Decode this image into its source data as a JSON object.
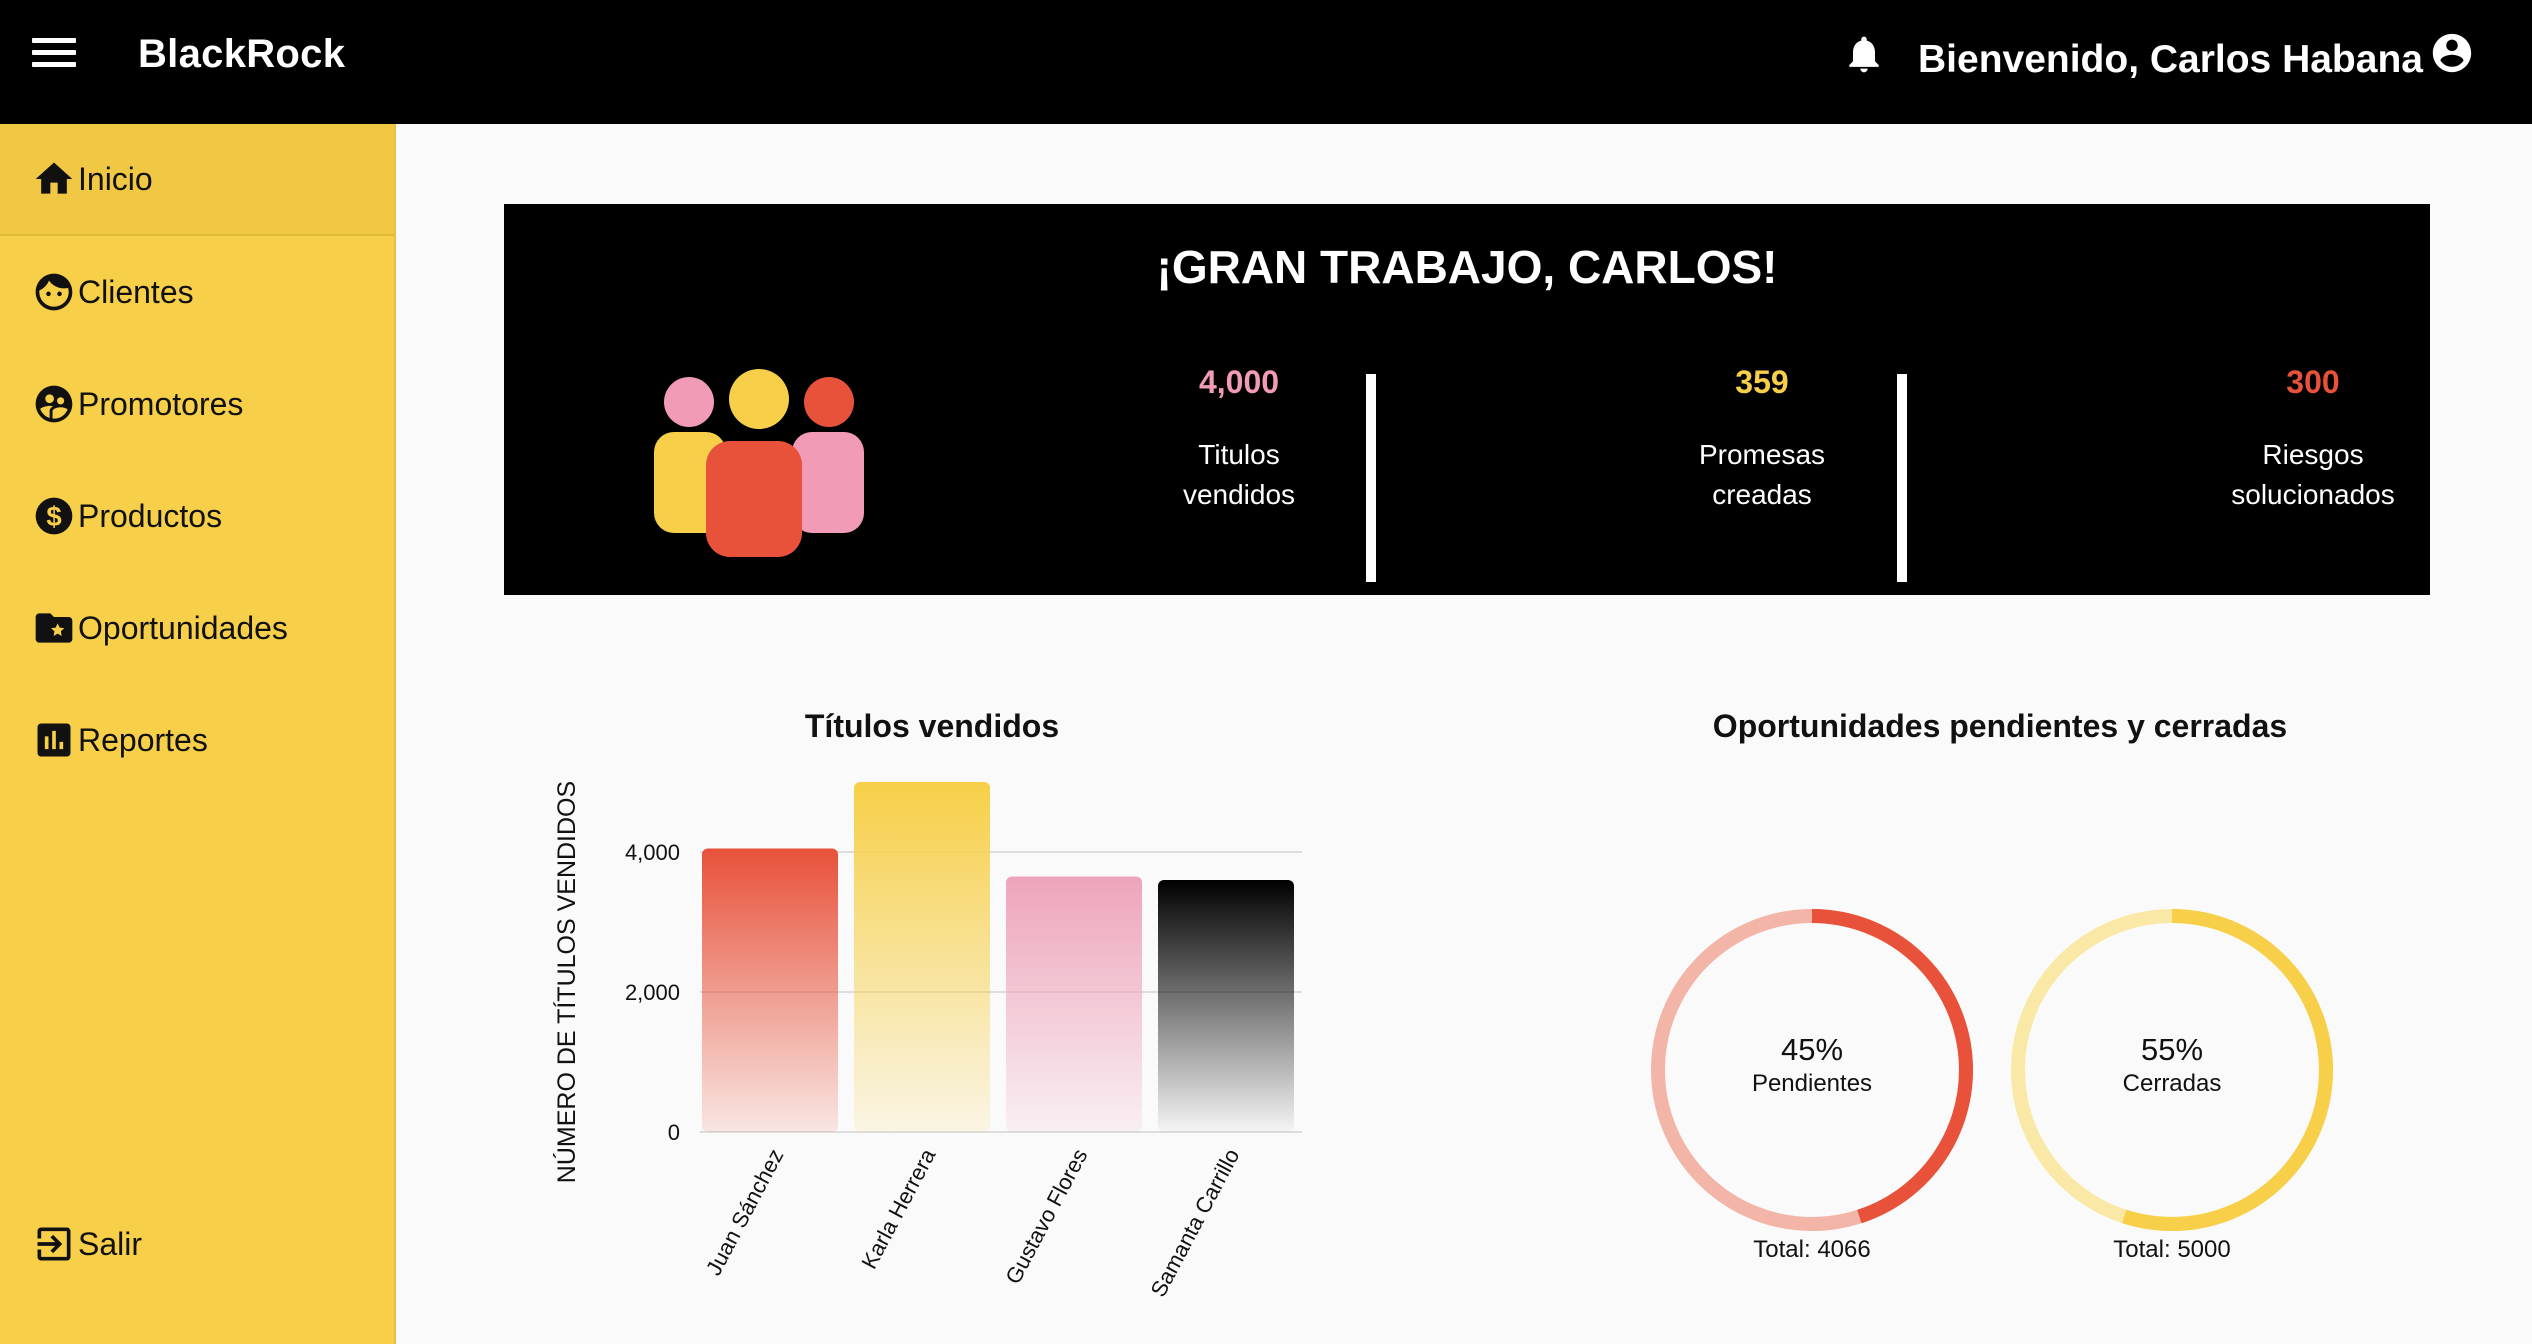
{
  "header": {
    "brand": "BlackRock",
    "welcome": "Bienvenido, Carlos Habana"
  },
  "sidebar": {
    "items": [
      {
        "label": "Inicio",
        "icon": "home-icon",
        "active": true
      },
      {
        "label": "Clientes",
        "icon": "face-icon"
      },
      {
        "label": "Promotores",
        "icon": "group-icon"
      },
      {
        "label": "Productos",
        "icon": "dollar-icon"
      },
      {
        "label": "Oportunidades",
        "icon": "folder-star-icon"
      },
      {
        "label": "Reportes",
        "icon": "bar-chart-icon"
      }
    ],
    "logout": {
      "label": "Salir",
      "icon": "logout-icon"
    }
  },
  "banner": {
    "title": "¡GRAN TRABAJO, CARLOS!",
    "stats": [
      {
        "value": "4,000",
        "line1": "Titulos",
        "line2": "vendidos",
        "color": "#f29bb6"
      },
      {
        "value": "359",
        "line1": "Promesas",
        "line2": "creadas",
        "color": "#f7cf48"
      },
      {
        "value": "300",
        "line1": "Riesgos",
        "line2": "solucionados",
        "color": "#e8513a"
      }
    ],
    "people_colors": [
      "#f29bb6",
      "#f7cf48",
      "#e8513a"
    ]
  },
  "chart_data": [
    {
      "type": "bar",
      "title": "Títulos vendidos",
      "ylabel": "NÚMERO DE TÍTULOS VENDIDOS",
      "xlabel": "",
      "categories": [
        "Juan Sánchez",
        "Karla Herrera",
        "Gustavo Flores",
        "Samanta Carrillo"
      ],
      "values": [
        4050,
        5000,
        3650,
        3600
      ],
      "ylim": [
        0,
        5000
      ],
      "yticks": [
        0,
        2000,
        4000
      ],
      "ytick_labels": [
        "0",
        "2,000",
        "4,000"
      ],
      "colors": [
        "#e8513a",
        "#f7cf48",
        "#eea4bb",
        "#000000"
      ],
      "grid": true
    },
    {
      "type": "pie",
      "title": "Oportunidades pendientes y cerradas",
      "donuts": [
        {
          "percent": 45,
          "pct_label": "45%",
          "label": "Pendientes",
          "total_label": "Total: 4066",
          "main_color": "#e8513a",
          "track_color": "#f2b5a8"
        },
        {
          "percent": 55,
          "pct_label": "55%",
          "label": "Cerradas",
          "total_label": "Total: 5000",
          "main_color": "#f7cf48",
          "track_color": "#fae9a6"
        }
      ]
    }
  ]
}
